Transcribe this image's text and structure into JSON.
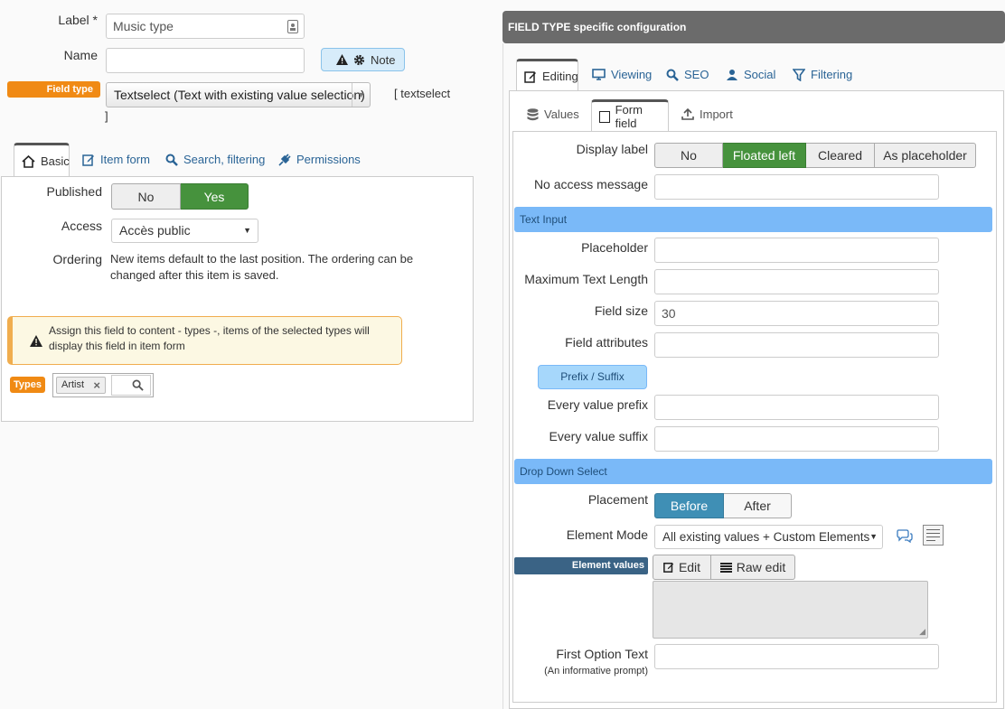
{
  "left": {
    "label_field": {
      "label": "Label *",
      "value": "Music type"
    },
    "name_field": {
      "label": "Name",
      "value": ""
    },
    "note_button": "Note",
    "field_type": {
      "tag": "Field type",
      "value": "Textselect (Text with existing value selection)",
      "hint_line1": "[ textselect",
      "hint_line2": "]"
    },
    "tabs": [
      {
        "label": "Basic"
      },
      {
        "label": "Item form"
      },
      {
        "label": "Search, filtering"
      },
      {
        "label": "Permissions"
      }
    ],
    "published": {
      "label": "Published",
      "options": [
        "No",
        "Yes"
      ],
      "selected": "Yes"
    },
    "access": {
      "label": "Access",
      "value": "Accès public"
    },
    "ordering": {
      "label": "Ordering",
      "text_line1": "New items default to the last position. The ordering can be",
      "text_line2": "changed after this item is saved."
    },
    "warning": {
      "line1": "Assign this field to content - types -, items of the selected types will",
      "line2": "display this field in item form"
    },
    "types": {
      "tag": "Types",
      "chip": "Artist",
      "chip_remove": "×"
    }
  },
  "right": {
    "header": "FIELD TYPE specific configuration",
    "tabs": [
      {
        "label": "Editing"
      },
      {
        "label": "Viewing"
      },
      {
        "label": "SEO"
      },
      {
        "label": "Social"
      },
      {
        "label": "Filtering"
      }
    ],
    "subtabs": [
      {
        "label": "Values"
      },
      {
        "label": "Form field"
      },
      {
        "label": "Import"
      }
    ],
    "display_label": {
      "label": "Display label",
      "options": [
        "No",
        "Floated left",
        "Cleared",
        "As placeholder"
      ],
      "selected": "Floated left"
    },
    "no_access_message": {
      "label": "No access message",
      "value": ""
    },
    "text_input_section": "Text Input",
    "placeholder": {
      "label": "Placeholder",
      "value": ""
    },
    "max_text_length": {
      "label": "Maximum Text Length",
      "value": ""
    },
    "field_size": {
      "label": "Field size",
      "value": "30"
    },
    "field_attributes": {
      "label": "Field attributes",
      "value": ""
    },
    "prefix_suffix_button": "Prefix / Suffix",
    "every_value_prefix": {
      "label": "Every value prefix",
      "value": ""
    },
    "every_value_suffix": {
      "label": "Every value suffix",
      "value": ""
    },
    "drop_down_section": "Drop Down Select",
    "placement": {
      "label": "Placement",
      "options": [
        "Before",
        "After"
      ],
      "selected": "Before"
    },
    "element_mode": {
      "label": "Element Mode",
      "value": "All existing values + Custom Elements"
    },
    "element_values": {
      "tag": "Element values",
      "edit": "Edit",
      "raw_edit": "Raw edit"
    },
    "first_option_text": {
      "label": "First Option Text",
      "sublabel": "(An informative prompt)",
      "value": ""
    }
  },
  "colors": {
    "accent_orange": "#f08a14",
    "green": "#46923d",
    "blue": "#3f8fb5",
    "section_blue": "#7ab9f8",
    "header_gray": "#6b6b6b"
  }
}
